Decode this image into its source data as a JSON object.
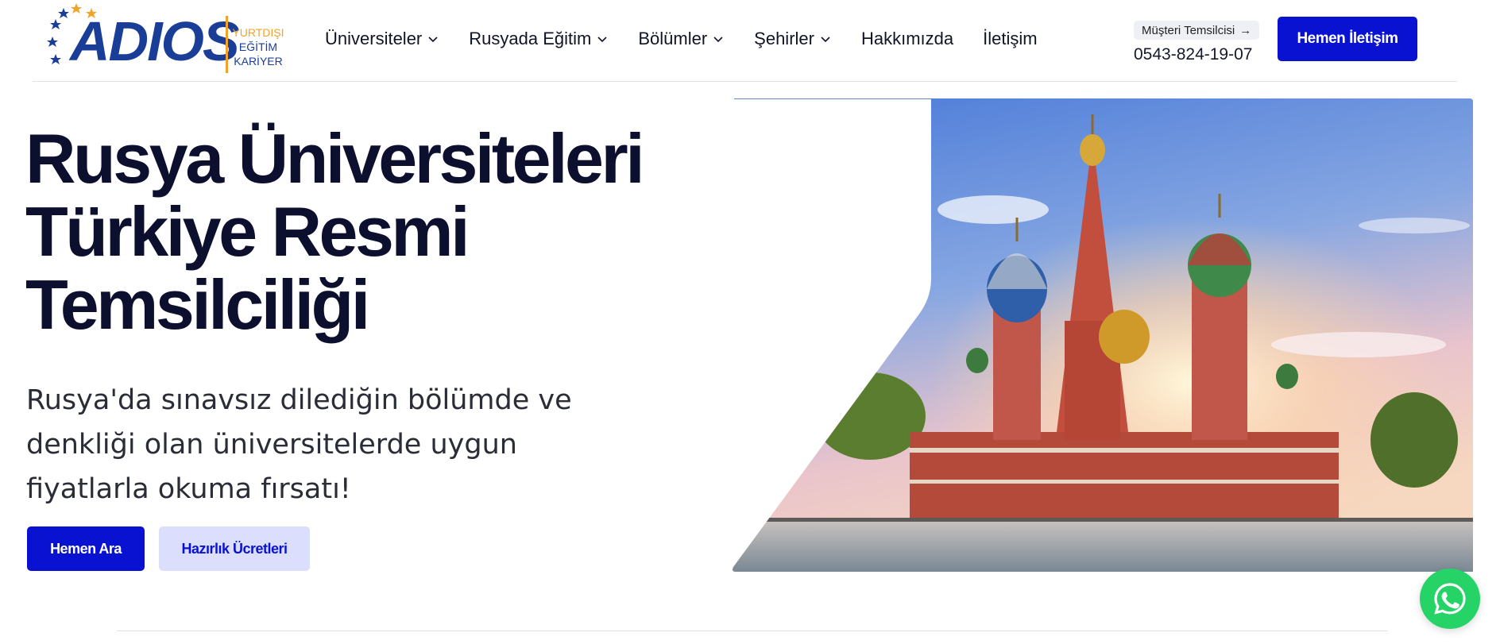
{
  "logo": {
    "word": "ADIOS",
    "tag_line1": "YURTDIŞI",
    "tag_line2": "EĞİTİM",
    "tag_line3": "KARİYER",
    "colors": {
      "blue": "#1a3e98",
      "orange": "#f2a22a"
    }
  },
  "nav": {
    "items": [
      {
        "label": "Üniversiteler",
        "icon": "chevron-down-icon"
      },
      {
        "label": "Rusyada Eğitim",
        "icon": "chevron-down-icon"
      },
      {
        "label": "Bölümler",
        "icon": "chevron-down-icon"
      },
      {
        "label": "Şehirler",
        "icon": "chevron-down-icon"
      },
      {
        "label": "Hakkımızda"
      },
      {
        "label": "İletişim"
      }
    ]
  },
  "rep": {
    "label": "Müşteri Temsilcisi",
    "arrow": "→",
    "phone": "0543-824-19-07"
  },
  "header_cta": "Hemen İletişim",
  "hero": {
    "title_lines": [
      "Rusya Üniversiteleri",
      "Türkiye Resmi",
      "Temsilciliği"
    ],
    "subtitle": "Rusya'da sınavsız dilediğin bölümde ve denkliği olan üniversitelerde uygun fiyatlarla okuma fırsatı!",
    "btn_call": "Hemen Ara",
    "btn_fees": "Hazırlık Ücretleri"
  },
  "whatsapp": {
    "icon": "whatsapp-icon"
  },
  "colors": {
    "primary": "#0a12d2",
    "primary_light": "#dcdefd",
    "heading": "#0d0f2e",
    "whatsapp": "#25d366"
  }
}
